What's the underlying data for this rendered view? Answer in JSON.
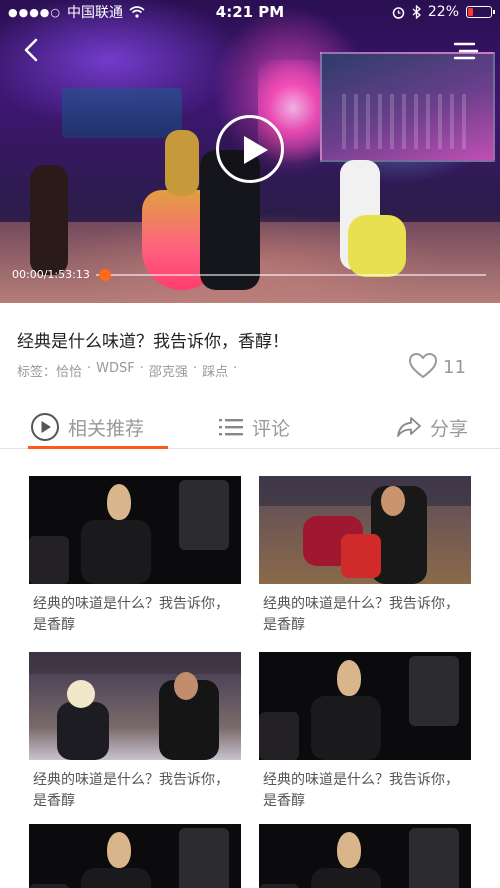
{
  "status_bar": {
    "signal": "●●●●○",
    "carrier": "中国联通",
    "time": "4:21 PM",
    "battery_percent": "22%",
    "battery_level": 0.22,
    "battery_color": "#ff3b30"
  },
  "player": {
    "time_display": "00:00/1:53:13",
    "progress": 0.0,
    "accent_color": "#ff6a1a",
    "icons": {
      "back": "back-chevron-icon",
      "more": "more-menu-icon",
      "play": "play-icon"
    }
  },
  "video": {
    "title": "经典是什么味道？我告诉你，香醇！",
    "tags_label": "标签：",
    "tags": [
      "恰恰",
      "WDSF",
      "邵克强",
      "踩点"
    ],
    "tag_separator": "·",
    "like_count": "11"
  },
  "tabs": [
    {
      "label": "相关推荐",
      "icon": "play-circle-icon",
      "active": true
    },
    {
      "label": "评论",
      "icon": "list-icon",
      "active": false
    },
    {
      "label": "分享",
      "icon": "share-icon",
      "active": false
    }
  ],
  "related": {
    "items": [
      {
        "title": "经典的味道是什么？我告诉你，是香醇",
        "thumb": "blonde"
      },
      {
        "title": "经典的味道是什么？我告诉你，是香醇",
        "thumb": "couple"
      },
      {
        "title": "经典的味道是什么？我告诉你，是香醇",
        "thumb": "latin"
      },
      {
        "title": "经典的味道是什么？我告诉你，是香醇",
        "thumb": "blonde"
      },
      {
        "title": "",
        "thumb": "blonde"
      },
      {
        "title": "",
        "thumb": "blonde"
      }
    ]
  }
}
